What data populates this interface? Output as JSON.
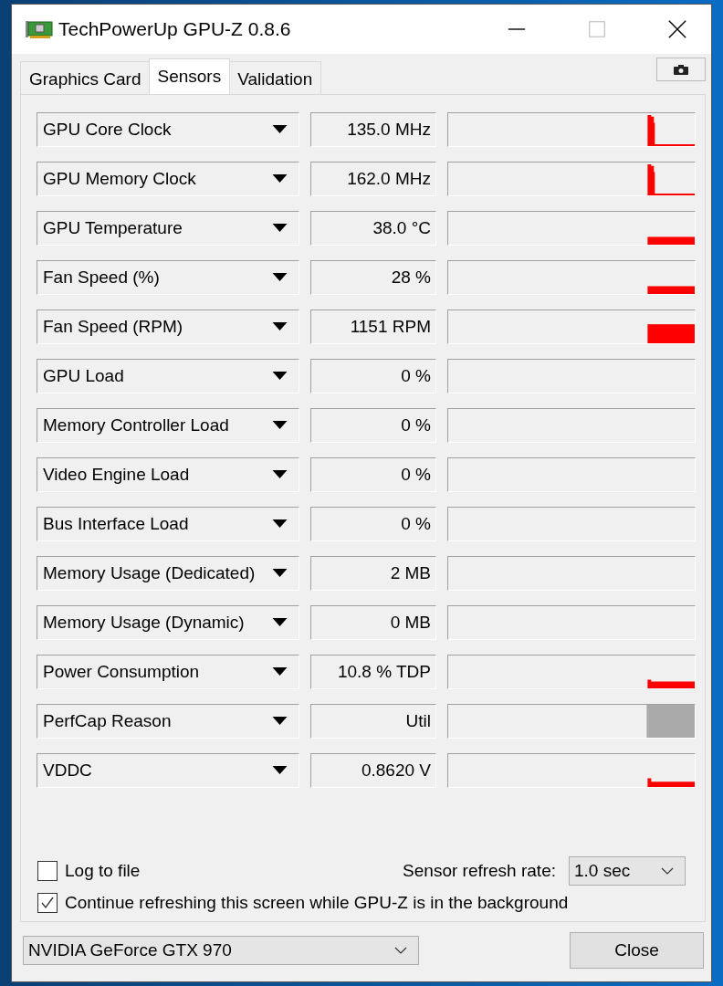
{
  "window": {
    "title": "TechPowerUp GPU-Z 0.8.6"
  },
  "tabs": [
    {
      "label": "Graphics Card",
      "selected": false
    },
    {
      "label": "Sensors",
      "selected": true
    },
    {
      "label": "Validation",
      "selected": false
    }
  ],
  "sensors": [
    {
      "name": "GPU Core Clock",
      "value": "135.0 MHz",
      "kind": "spike"
    },
    {
      "name": "GPU Memory Clock",
      "value": "162.0 MHz",
      "kind": "spike"
    },
    {
      "name": "GPU Temperature",
      "value": "38.0 °C",
      "kind": "block"
    },
    {
      "name": "Fan Speed (%)",
      "value": "28 %",
      "kind": "block"
    },
    {
      "name": "Fan Speed (RPM)",
      "value": "1151 RPM",
      "kind": "tall-block"
    },
    {
      "name": "GPU Load",
      "value": "0 %",
      "kind": "empty"
    },
    {
      "name": "Memory Controller Load",
      "value": "0 %",
      "kind": "empty"
    },
    {
      "name": "Video Engine Load",
      "value": "0 %",
      "kind": "empty"
    },
    {
      "name": "Bus Interface Load",
      "value": "0 %",
      "kind": "empty"
    },
    {
      "name": "Memory Usage (Dedicated)",
      "value": "2 MB",
      "kind": "empty"
    },
    {
      "name": "Memory Usage (Dynamic)",
      "value": "0 MB",
      "kind": "empty"
    },
    {
      "name": "Power Consumption",
      "value": "10.8 % TDP",
      "kind": "step"
    },
    {
      "name": "PerfCap Reason",
      "value": "Util",
      "kind": "gray"
    },
    {
      "name": "VDDC",
      "value": "0.8620 V",
      "kind": "step-block"
    }
  ],
  "log_to_file": {
    "label": "Log to file",
    "checked": false
  },
  "refresh_rate": {
    "label": "Sensor refresh rate:",
    "value": "1.0 sec"
  },
  "continue_refreshing": {
    "label": "Continue refreshing this screen while GPU-Z is in the background",
    "checked": true
  },
  "gpu_select": {
    "value": "NVIDIA GeForce GTX 970"
  },
  "close_button": {
    "label": "Close"
  }
}
